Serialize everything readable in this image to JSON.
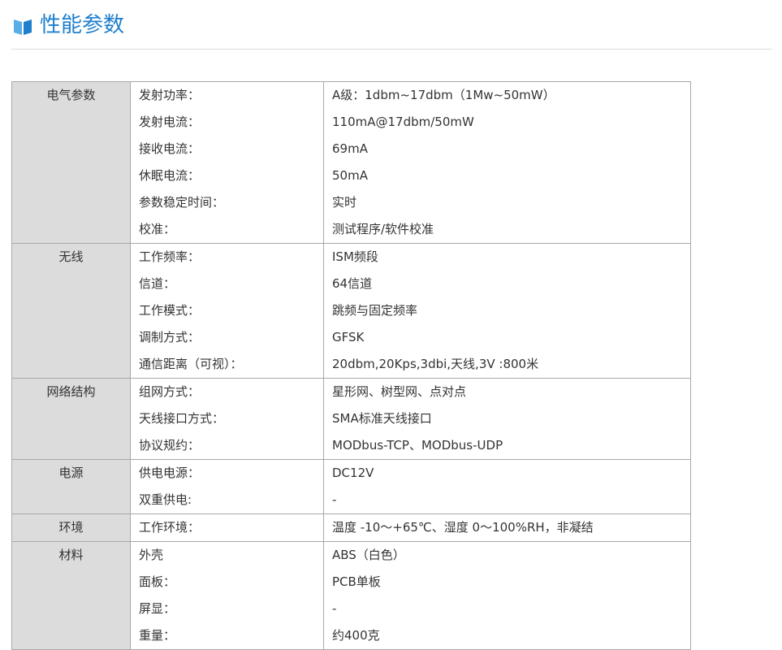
{
  "header": {
    "icon": "book-icon",
    "title": "性能参数",
    "accent_color": "#1e7fce"
  },
  "groups": [
    {
      "category": "电气参数",
      "rows": [
        {
          "label": "发射功率：",
          "value": "A级：1dbm~17dbm（1Mw~50mW）"
        },
        {
          "label": "发射电流：",
          "value": "110mA@17dbm/50mW"
        },
        {
          "label": "接收电流：",
          "value": "69mA"
        },
        {
          "label": "休眠电流：",
          "value": "50mA"
        },
        {
          "label": "参数稳定时间：",
          "value": "实时"
        },
        {
          "label": "校准：",
          "value": "测试程序/软件校准"
        }
      ]
    },
    {
      "category": "无线",
      "rows": [
        {
          "label": "工作频率：",
          "value": "ISM频段"
        },
        {
          "label": "信道：",
          "value": "64信道"
        },
        {
          "label": "工作模式：",
          "value": "跳频与固定频率"
        },
        {
          "label": "调制方式：",
          "value": "GFSK"
        },
        {
          "label": "通信距离（可视）：",
          "value": "20dbm,20Kps,3dbi,天线,3V :800米"
        }
      ]
    },
    {
      "category": "网络结构",
      "rows": [
        {
          "label": "组网方式：",
          "value": "星形网、树型网、点对点"
        },
        {
          "label": "天线接口方式：",
          "value": "SMA标准天线接口"
        },
        {
          "label": "协议规约：",
          "value": "MODbus-TCP、MODbus-UDP"
        }
      ]
    },
    {
      "category": "电源",
      "rows": [
        {
          "label": "供电电源：",
          "value": "DC12V"
        },
        {
          "label": "双重供电:",
          "value": "-"
        }
      ]
    },
    {
      "category": "环境",
      "rows": [
        {
          "label": "工作环境：",
          "value": "温度 -10～+65℃、湿度 0～100%RH，非凝结"
        }
      ]
    },
    {
      "category": "材料",
      "rows": [
        {
          "label": "外壳",
          "value": "ABS（白色）"
        },
        {
          "label": "面板：",
          "value": "PCB单板"
        },
        {
          "label": "屏显：",
          "value": "-"
        },
        {
          "label": "重量：",
          "value": "约400克"
        }
      ]
    }
  ]
}
